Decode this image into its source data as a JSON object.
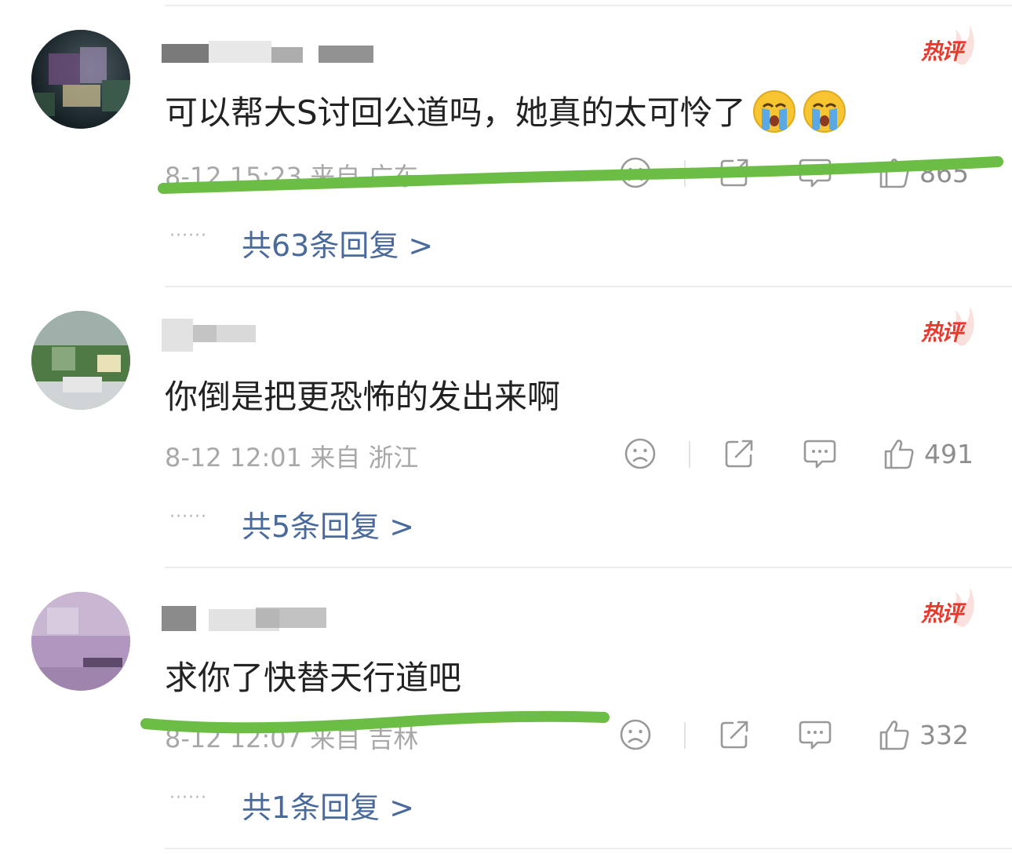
{
  "hot_label": "热评",
  "comments": [
    {
      "text": "可以帮大S讨回公道吗，她真的太可怜了",
      "emojis": [
        "crying-face-emoji",
        "crying-face-emoji"
      ],
      "meta": "8-12 15:23 来自 广东",
      "likes": "865",
      "replies": "共63条回复 >"
    },
    {
      "text": "你倒是把更恐怖的发出来啊",
      "emojis": [],
      "meta": "8-12 12:01 来自 浙江",
      "likes": "491",
      "replies": "共5条回复 >"
    },
    {
      "text": "求你了快替天行道吧",
      "emojis": [],
      "meta": "8-12 12:07 来自 吉林",
      "likes": "332",
      "replies": "共1条回复 >"
    }
  ],
  "dots": "······",
  "colors": {
    "hot_red": "#e63a2e",
    "reply_link": "#4a6a9c",
    "highlight_stroke": "#6cbd45",
    "meta_gray": "#a8a8a8"
  },
  "icons": {
    "dislike": "sad-face-icon",
    "share": "share-icon",
    "comment": "comment-bubble-icon",
    "like": "thumbs-up-icon"
  }
}
